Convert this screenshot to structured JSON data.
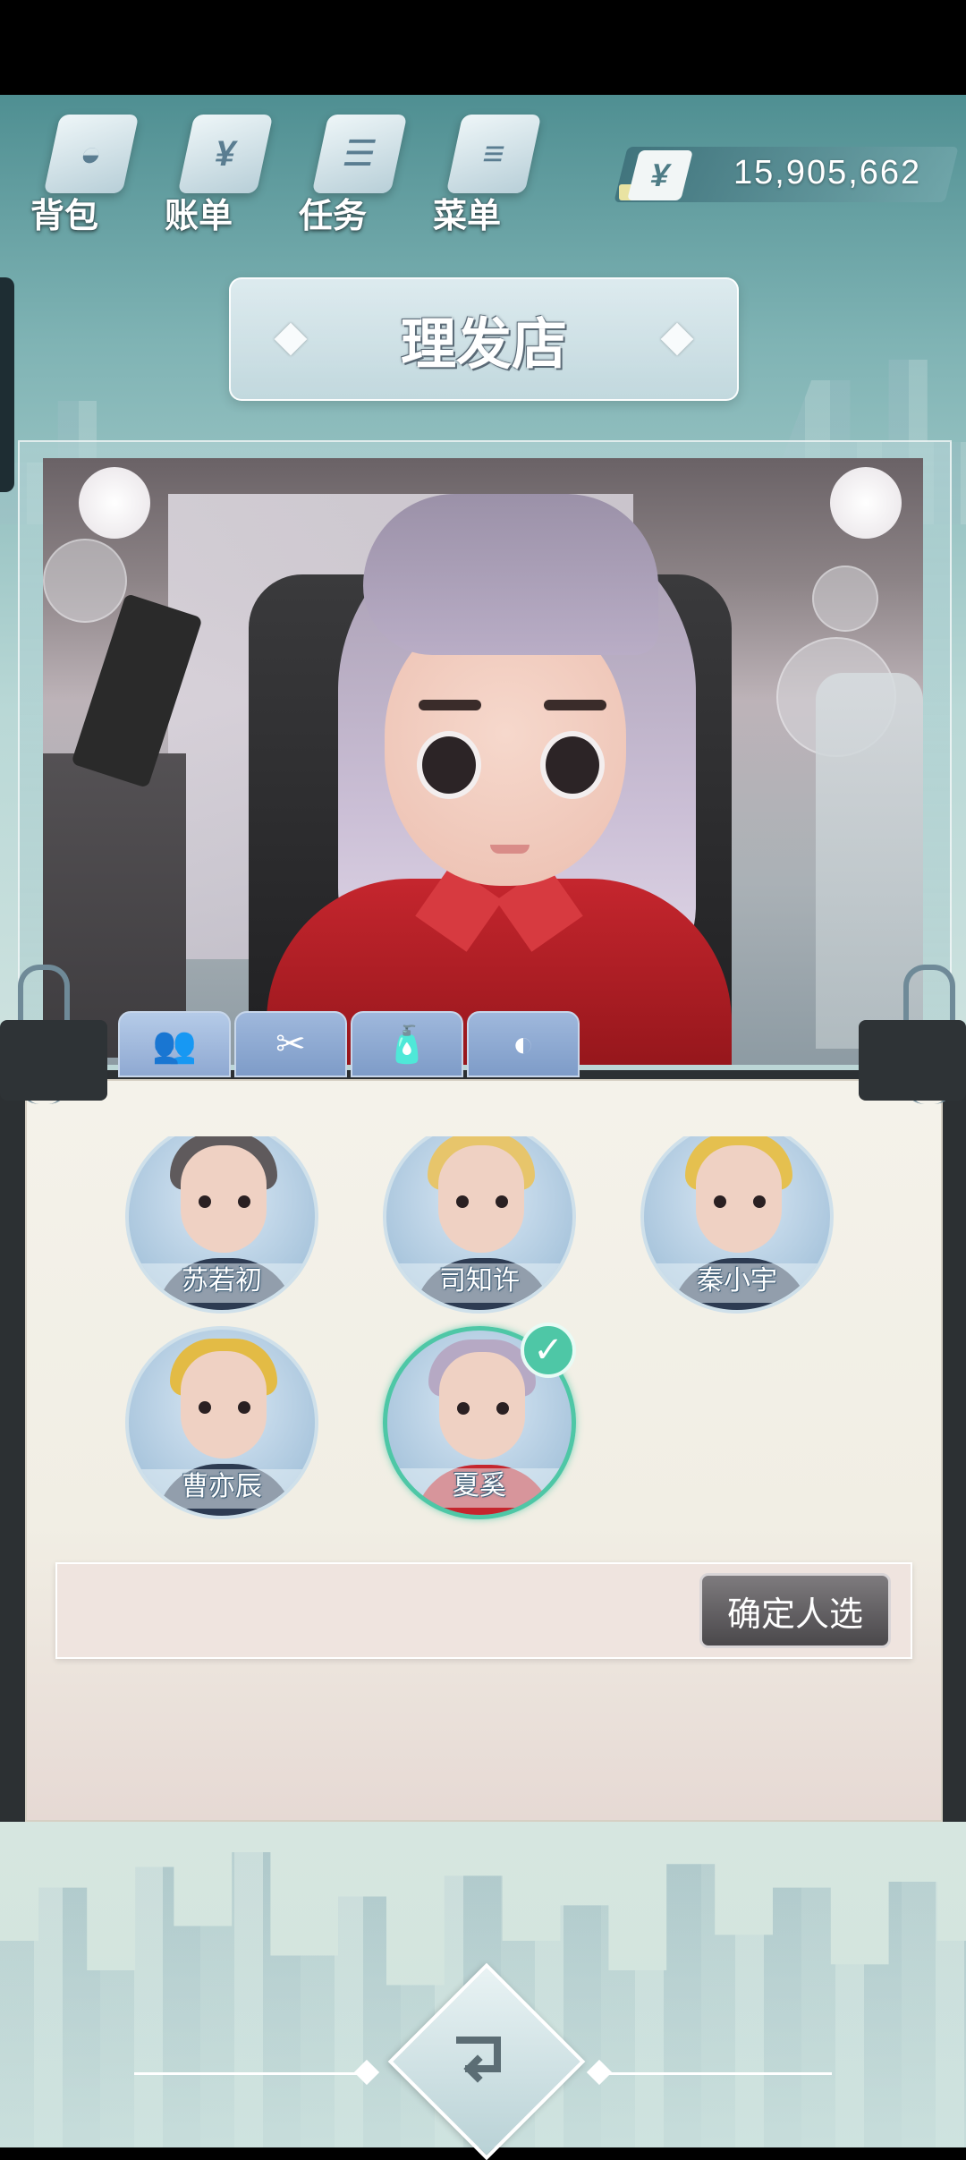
{
  "nav": {
    "items": [
      {
        "label": "背包",
        "icon": "backpack-icon"
      },
      {
        "label": "账单",
        "icon": "bill-icon"
      },
      {
        "label": "任务",
        "icon": "task-icon"
      },
      {
        "label": "菜单",
        "icon": "menu-icon"
      }
    ]
  },
  "currency": {
    "symbol": "¥",
    "amount": "15,905,662"
  },
  "title": "理发店",
  "tabs": [
    {
      "icon": "characters-icon",
      "active": true
    },
    {
      "icon": "scissors-icon",
      "active": false
    },
    {
      "icon": "hair-dye-icon",
      "active": false
    },
    {
      "icon": "makeup-icon",
      "active": false
    }
  ],
  "characters": [
    {
      "name": "苏若初",
      "hair": "#5f5a5c",
      "selected": false
    },
    {
      "name": "司知许",
      "hair": "#e7c56b",
      "selected": false
    },
    {
      "name": "秦小宇",
      "hair": "#e5c04f",
      "selected": false
    },
    {
      "name": "曹亦辰",
      "hair": "#e3bb45",
      "selected": false
    },
    {
      "name": "夏奚",
      "hair": "#b6a9c4",
      "selected": true
    }
  ],
  "confirm_button": "确定人选",
  "colors": {
    "accent": "#4ec7a6",
    "tab": "#8fa9d2",
    "shirt": "#c5262e"
  }
}
